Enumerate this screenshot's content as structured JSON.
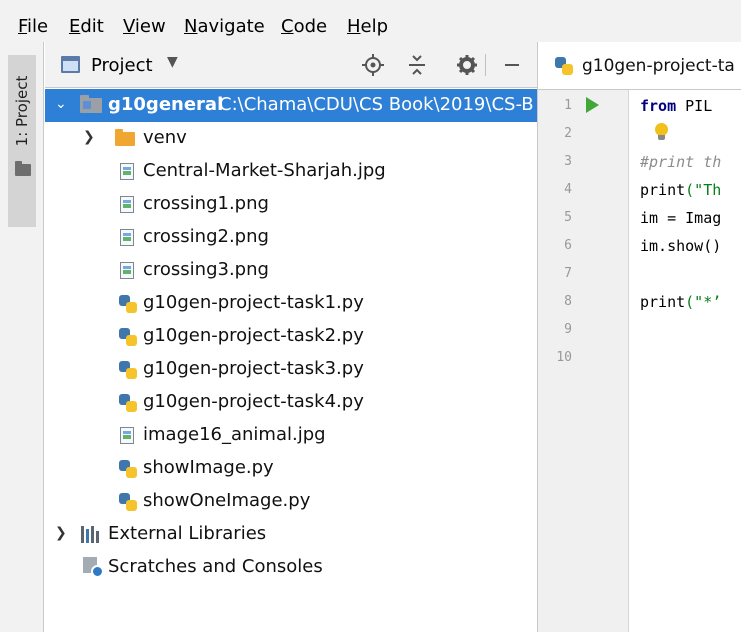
{
  "menu": [
    {
      "mnemonic": "F",
      "rest": "ile"
    },
    {
      "mnemonic": "E",
      "rest": "dit"
    },
    {
      "mnemonic": "V",
      "rest": "iew"
    },
    {
      "mnemonic": "N",
      "rest": "avigate"
    },
    {
      "mnemonic": "C",
      "rest": "ode"
    },
    {
      "mnemonic": "H",
      "rest": "elp"
    }
  ],
  "tool_window_strip": {
    "label": "1: Project"
  },
  "project_panel": {
    "title": "Project",
    "header_icons": [
      "locate-icon",
      "collapse-all-icon",
      "gear-icon",
      "hide-icon"
    ],
    "root": {
      "name": "g10general",
      "path": "C:\\Chama\\CDU\\CS Book\\2019\\CS-B"
    },
    "items": [
      {
        "name": "venv",
        "type": "folder",
        "icon": "folder-icon"
      },
      {
        "name": "Central-Market-Sharjah.jpg",
        "type": "image",
        "icon": "image-file-icon"
      },
      {
        "name": "crossing1.png",
        "type": "image",
        "icon": "image-file-icon"
      },
      {
        "name": "crossing2.png",
        "type": "image",
        "icon": "image-file-icon"
      },
      {
        "name": "crossing3.png",
        "type": "image",
        "icon": "image-file-icon"
      },
      {
        "name": "g10gen-project-task1.py",
        "type": "python",
        "icon": "python-file-icon"
      },
      {
        "name": "g10gen-project-task2.py",
        "type": "python",
        "icon": "python-file-icon"
      },
      {
        "name": "g10gen-project-task3.py",
        "type": "python",
        "icon": "python-file-icon"
      },
      {
        "name": "g10gen-project-task4.py",
        "type": "python",
        "icon": "python-file-icon"
      },
      {
        "name": "image16_animal.jpg",
        "type": "image",
        "icon": "image-file-icon"
      },
      {
        "name": "showImage.py",
        "type": "python",
        "icon": "python-file-icon"
      },
      {
        "name": "showOneImage.py",
        "type": "python",
        "icon": "python-file-icon"
      }
    ],
    "external_libraries": "External Libraries",
    "scratches": "Scratches and Consoles"
  },
  "editor": {
    "tab_label": "g10gen-project-ta",
    "line_numbers": [
      "1",
      "2",
      "3",
      "4",
      "5",
      "6",
      "7",
      "8",
      "9",
      "10"
    ],
    "code": {
      "l1_kw": "from",
      "l1_rest": " PIL",
      "l3": "#print th",
      "l4_fn": "print",
      "l4_str": "(\"Th",
      "l5": "im = Imag",
      "l6": "im.show()",
      "l8_fn": "print",
      "l8_str": "(\"*’"
    }
  },
  "colors": {
    "selection": "#2e7fd6",
    "run_icon": "#41a838",
    "folder": "#f0a732",
    "keyword": "#000080",
    "string": "#067d17"
  }
}
